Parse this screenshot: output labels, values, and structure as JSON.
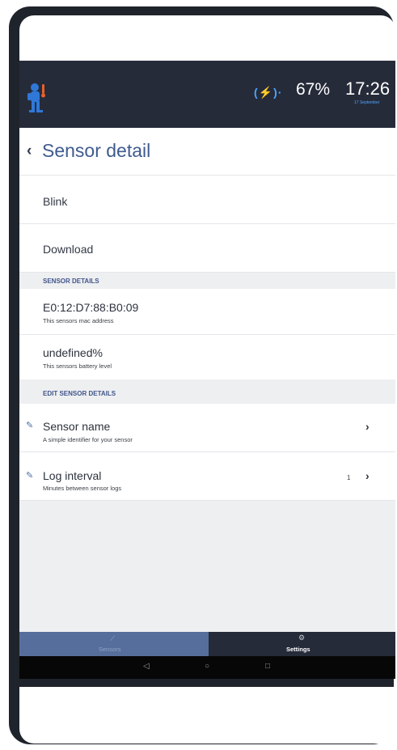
{
  "status_bar": {
    "charging_icon": "charging-icon",
    "battery_percent": "67%",
    "time": "17:26",
    "date": "17 September"
  },
  "title_bar": {
    "title": "Sensor detail",
    "back_icon": "chevron-left-icon"
  },
  "actions": [
    {
      "label": "Blink"
    },
    {
      "label": "Download"
    }
  ],
  "sensor_details": {
    "header": "SENSOR DETAILS",
    "mac_address": "E0:12:D7:88:B0:09",
    "mac_caption": "This sensors mac address",
    "battery": "undefined%",
    "battery_caption": "This sensors battery level"
  },
  "edit_sensor_details": {
    "header": "EDIT SENSOR DETAILS",
    "items": [
      {
        "title": "Sensor name",
        "subtitle": "A simple identifier for your sensor",
        "value": "",
        "icon": "pencil-icon"
      },
      {
        "title": "Log interval",
        "subtitle": "Minutes between sensor logs",
        "value": "1",
        "icon": "pencil-icon"
      }
    ]
  },
  "tabs": [
    {
      "label": "Sensors",
      "icon": "chart-icon",
      "active": true
    },
    {
      "label": "Settings",
      "icon": "gear-icon",
      "active": false
    }
  ],
  "colors": {
    "header_bg": "#262b3a",
    "accent": "#3f5b8e",
    "active_tab_bg": "#566e9b",
    "charging_blue": "#4da6ff"
  }
}
